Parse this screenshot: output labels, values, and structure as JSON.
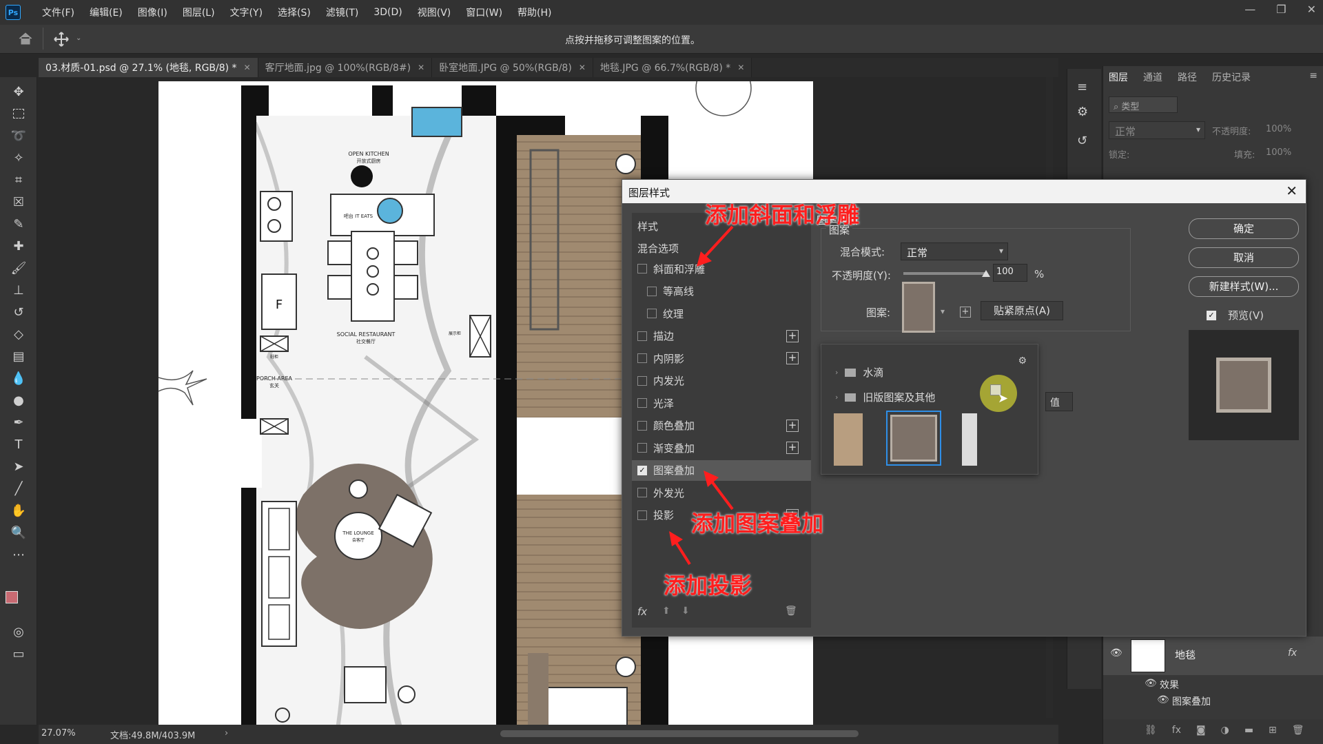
{
  "app": {
    "logo": "Ps"
  },
  "menu": [
    "文件(F)",
    "编辑(E)",
    "图像(I)",
    "图层(L)",
    "文字(Y)",
    "选择(S)",
    "滤镜(T)",
    "3D(D)",
    "视图(V)",
    "窗口(W)",
    "帮助(H)"
  ],
  "window_controls": [
    "—",
    "❐",
    "✕"
  ],
  "options_bar": {
    "hint": "点按并拖移可调整图案的位置。"
  },
  "tabs": [
    {
      "label": "03.材质-01.psd @ 27.1% (地毯, RGB/8) *",
      "active": true
    },
    {
      "label": "客厅地面.jpg @ 100%(RGB/8#)",
      "active": false
    },
    {
      "label": "卧室地面.JPG @ 50%(RGB/8)",
      "active": false
    },
    {
      "label": "地毯.JPG @ 66.7%(RGB/8) *",
      "active": false
    }
  ],
  "status": {
    "zoom": "27.07%",
    "doc": "文档:49.8M/403.9M"
  },
  "plan_labels": {
    "kitchen": "OPEN KITCHEN",
    "kitchen_cn": "开放式厨房",
    "restaurant": "SOCIAL RESTAURANT",
    "restaurant_cn": "社交餐厅",
    "porch": "PORCH AREA",
    "porch_cn": "玄关",
    "lounge": "THE LOUNGE",
    "lounge_cn": "会客厅",
    "fridge": "F",
    "eat": "吧台 IT EATS",
    "cabinet": "鞋柜",
    "display": "展示柜"
  },
  "layers_panel": {
    "tabs": [
      "图层",
      "通道",
      "路径",
      "历史记录"
    ],
    "filter_placeholder": "类型",
    "blend": "正常",
    "opacity_label": "不透明度:",
    "opacity": "100%",
    "lock_label": "锁定:",
    "fill_label": "填充:",
    "fill": "100%",
    "layer_name": "地毯",
    "fx": "fx",
    "effects_label": "效果",
    "effect_item": "图案叠加"
  },
  "dialog": {
    "title": "图层样式",
    "styles_header": "样式",
    "blend_options": "混合选项",
    "styles": [
      {
        "label": "斜面和浮雕",
        "checked": false,
        "plus": false,
        "indent": false,
        "active": false
      },
      {
        "label": "等高线",
        "checked": false,
        "plus": false,
        "indent": true,
        "active": false
      },
      {
        "label": "纹理",
        "checked": false,
        "plus": false,
        "indent": true,
        "active": false
      },
      {
        "label": "描边",
        "checked": false,
        "plus": true,
        "indent": false,
        "active": false
      },
      {
        "label": "内阴影",
        "checked": false,
        "plus": true,
        "indent": false,
        "active": false
      },
      {
        "label": "内发光",
        "checked": false,
        "plus": false,
        "indent": false,
        "active": false
      },
      {
        "label": "光泽",
        "checked": false,
        "plus": false,
        "indent": false,
        "active": false
      },
      {
        "label": "颜色叠加",
        "checked": false,
        "plus": true,
        "indent": false,
        "active": false
      },
      {
        "label": "渐变叠加",
        "checked": false,
        "plus": true,
        "indent": false,
        "active": false
      },
      {
        "label": "图案叠加",
        "checked": true,
        "plus": false,
        "indent": false,
        "active": true
      },
      {
        "label": "外发光",
        "checked": false,
        "plus": false,
        "indent": false,
        "active": false
      },
      {
        "label": "投影",
        "checked": false,
        "plus": true,
        "indent": false,
        "active": false
      }
    ],
    "panel_title": "图案叠加",
    "group_title": "图案",
    "blend_mode_label": "混合模式:",
    "blend_mode_value": "正常",
    "opacity_label": "不透明度(Y):",
    "opacity_value": "100",
    "opacity_unit": "%",
    "opacity_level": 1.0,
    "pattern_label": "图案:",
    "snap_origin": "贴紧原点(A)",
    "pattern_groups": [
      "水滴",
      "旧版图案及其他"
    ],
    "hidden_btn": "值",
    "buttons": {
      "ok": "确定",
      "cancel": "取消",
      "new_style": "新建样式(W)...",
      "preview": "预览(V)"
    }
  },
  "annotations": {
    "bevel": "添加斜面和浮雕",
    "pattern": "添加图案叠加",
    "shadow": "添加投影"
  },
  "colors": {
    "annotation": "#ff1e1e",
    "wood": "#a08a70",
    "rug": "#7d7168",
    "accent_blue": "#5bb4dc",
    "cursor_highlight": "#c8c832"
  }
}
